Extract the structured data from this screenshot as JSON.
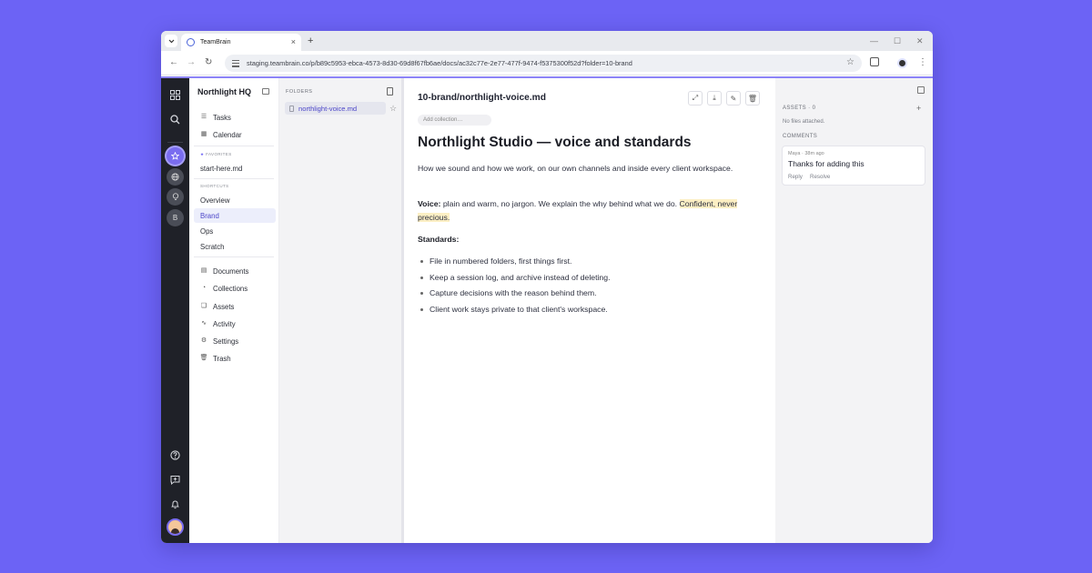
{
  "browser": {
    "tab_title": "TeamBrain",
    "url": "staging.teambrain.co/p/b89c5953-ebca-4573-8d30-69d8f67fb6ae/docs/ac32c77e-2e77-477f-9474-f5375300f52d?folder=10-brand",
    "new_tab": "+",
    "close_tab": "×",
    "min": "—",
    "max": "☐",
    "close": "✕",
    "back": "←",
    "forward": "→",
    "reload": "↻",
    "star": "☆",
    "more": "⋮",
    "dropdown": "⌄"
  },
  "rail": {
    "workspace_b": "B"
  },
  "sidebar": {
    "title": "Northlight HQ",
    "tasks": "Tasks",
    "calendar": "Calendar",
    "favorites_caption": "FAVORITES",
    "favorite_1": "start-here.md",
    "shortcuts_caption": "SHORTCUTS",
    "shortcut_overview": "Overview",
    "shortcut_brand": "Brand",
    "shortcut_ops": "Ops",
    "shortcut_scratch": "Scratch",
    "documents": "Documents",
    "collections": "Collections",
    "assets": "Assets",
    "activity": "Activity",
    "settings": "Settings",
    "trash": "Trash"
  },
  "folders": {
    "header": "FOLDERS",
    "file": "northlight-voice.md"
  },
  "doc": {
    "path": "10-brand/northlight-voice.md",
    "collection_placeholder": "Add collection…",
    "title": "Northlight Studio — voice and standards",
    "intro": "How we sound and how we work, on our own channels and inside every client workspace.",
    "voice_label": "Voice:",
    "voice_text": " plain and warm, no jargon. We explain the why behind what we do. ",
    "voice_highlight": "Confident, never precious.",
    "standards_label": "Standards:",
    "standards": [
      "File in numbered folders, first things first.",
      "Keep a session log, and archive instead of deleting.",
      "Capture decisions with the reason behind them.",
      "Client work stays private to that client's workspace."
    ]
  },
  "panel": {
    "assets_caption": "ASSETS · 0",
    "assets_empty": "No files attached.",
    "comments_caption": "COMMENTS",
    "add": "+",
    "comment": {
      "meta": "Maya · 38m ago",
      "body": "Thanks for adding this",
      "reply": "Reply",
      "resolve": "Resolve"
    }
  }
}
